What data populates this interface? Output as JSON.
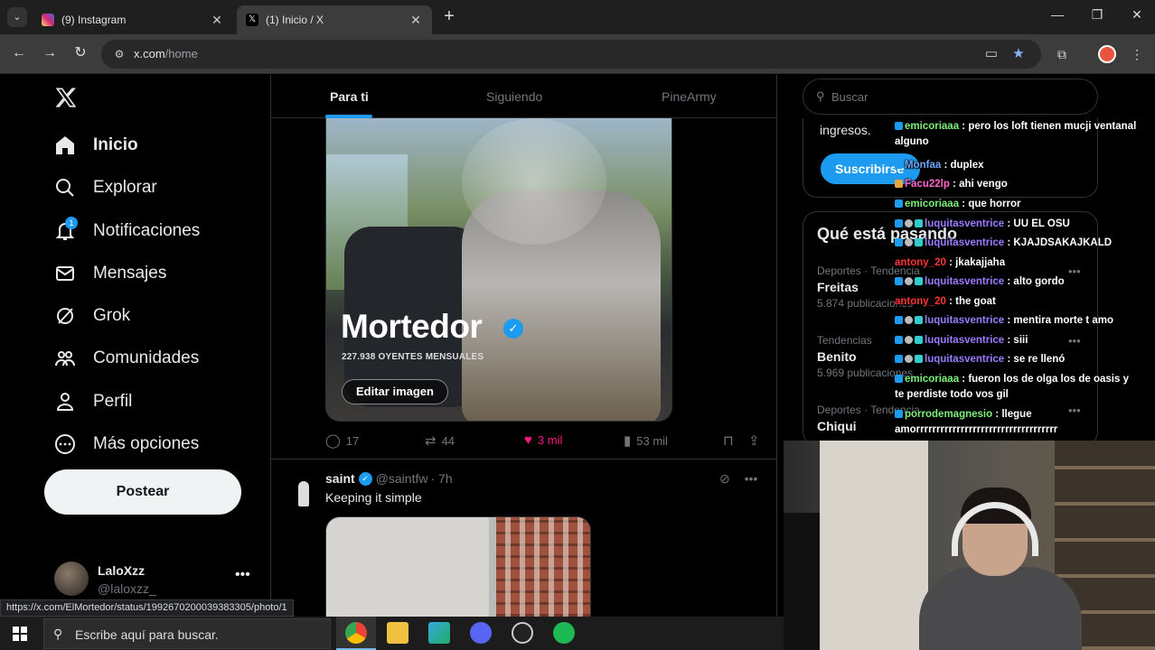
{
  "browser": {
    "tabs": [
      {
        "title": "(9) Instagram",
        "color": "#d62976"
      },
      {
        "title": "(1) Inicio / X",
        "color": "#000000"
      }
    ],
    "new_tab": "+",
    "url_host": "x.com",
    "url_path": "/home",
    "status_url": "https://x.com/ElMortedor/status/1992670200039383305/photo/1"
  },
  "nav": {
    "items": [
      {
        "label": "Inicio",
        "icon": "home-icon"
      },
      {
        "label": "Explorar",
        "icon": "search-icon"
      },
      {
        "label": "Notificaciones",
        "icon": "bell-icon",
        "badge": "1"
      },
      {
        "label": "Mensajes",
        "icon": "mail-icon"
      },
      {
        "label": "Grok",
        "icon": "grok-icon"
      },
      {
        "label": "Comunidades",
        "icon": "communities-icon"
      },
      {
        "label": "Perfil",
        "icon": "person-icon"
      },
      {
        "label": "Más opciones",
        "icon": "more-circle-icon"
      }
    ],
    "post_label": "Postear",
    "account": {
      "name": "LaloXzz",
      "handle": "@laloxzz_"
    }
  },
  "feed": {
    "tabs": [
      "Para ti",
      "Siguiendo",
      "PineArmy"
    ],
    "tweet1": {
      "image_title": "Mortedor",
      "listeners": "227.938 OYENTES MENSUALES",
      "edit_label": "Editar imagen",
      "replies": "17",
      "reposts": "44",
      "likes": "3 mil",
      "views": "53 mil"
    },
    "tweet2": {
      "name": "saint",
      "handle": "@saintfw",
      "time": "· 7h",
      "text": "Keeping it simple"
    }
  },
  "sidebar": {
    "search_placeholder": "Buscar",
    "premium_text": "ingresos.",
    "subscribe_label": "Suscribirse",
    "trending_title": "Qué está pasando",
    "trends": [
      {
        "category": "Deportes · Tendencia",
        "name": "Freitas",
        "posts": "5.874 publicaciones"
      },
      {
        "category": "Tendencias",
        "name": "Benito",
        "posts": "5.969 publicaciones"
      },
      {
        "category": "Deportes · Tendencia",
        "name": "Chiqui",
        "posts": ""
      }
    ]
  },
  "chat": [
    {
      "user": "emicoriaaa",
      "color": "#7cf078",
      "text": " : pero los loft tienen mucji ventanal alguno"
    },
    {
      "user": "Monfaa",
      "color": "#6aa8ff",
      "text": " : duplex"
    },
    {
      "user": "Facu22lp",
      "color": "#ff66cc",
      "text": " : ahi vengo"
    },
    {
      "user": "emicoriaaa",
      "color": "#7cf078",
      "text": " : que horror"
    },
    {
      "user": "luquitasventrice",
      "color": "#9b7bff",
      "text": " : UU EL OSU"
    },
    {
      "user": "luquitasventrice",
      "color": "#9b7bff",
      "text": " : KJAJDSAKAJKALD"
    },
    {
      "user": "antony_20",
      "color": "#ff3333",
      "text": " : jkakajjaha"
    },
    {
      "user": "luquitasventrice",
      "color": "#9b7bff",
      "text": " : alto gordo"
    },
    {
      "user": "antony_20",
      "color": "#ff3333",
      "text": " : the goat"
    },
    {
      "user": "luquitasventrice",
      "color": "#9b7bff",
      "text": " : mentira morte t amo"
    },
    {
      "user": "luquitasventrice",
      "color": "#9b7bff",
      "text": " : siii"
    },
    {
      "user": "luquitasventrice",
      "color": "#9b7bff",
      "text": " : se re llenó"
    },
    {
      "user": "emicoriaaa",
      "color": "#7cf078",
      "text": " : fueron los de olga los de oasis y te perdiste todo vos gil"
    },
    {
      "user": "porrodemagnesio",
      "color": "#7cf078",
      "text": " : llegue amorrrrrrrrrrrrrrrrrrrrrrrrrrrrrrrrrrr"
    }
  ],
  "taskbar": {
    "search_placeholder": "Escribe aquí para buscar."
  },
  "colors": {
    "accent": "#1d9bf0",
    "like": "#f91880"
  }
}
